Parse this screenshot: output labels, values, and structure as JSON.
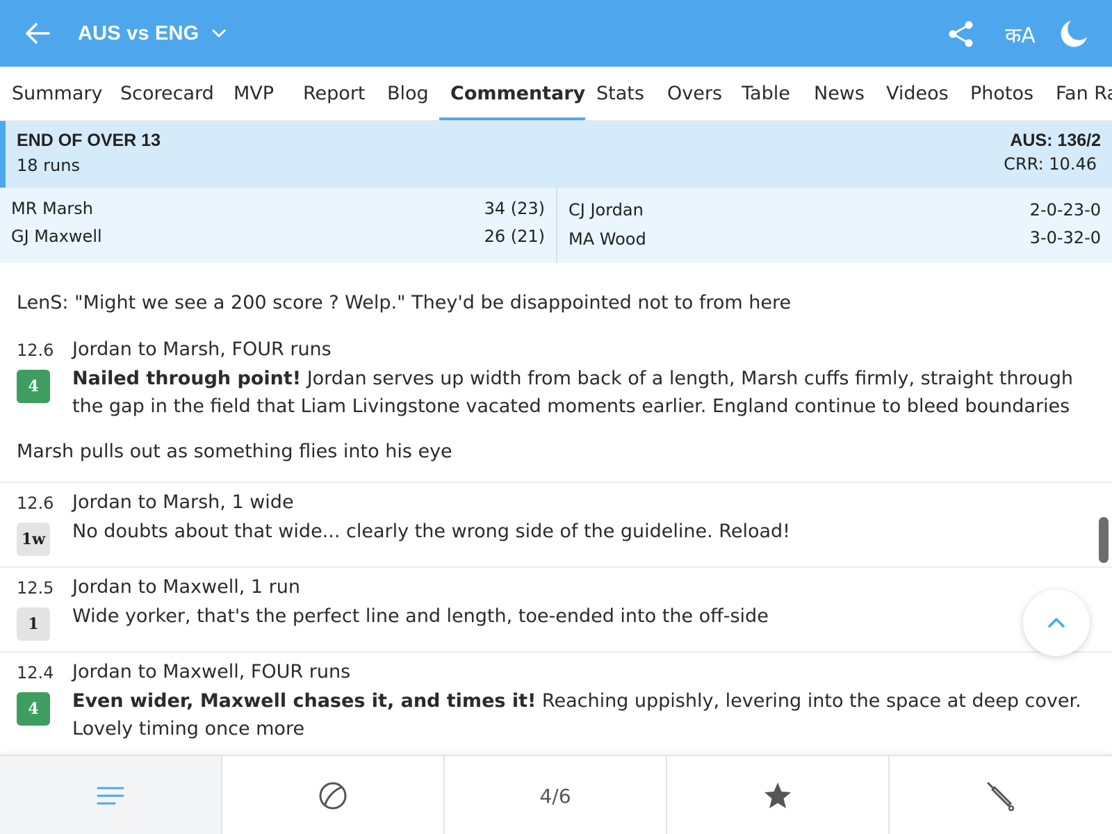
{
  "header": {
    "title": "AUS vs ENG",
    "lang_label": "कA",
    "colors": {
      "bar": "#4ea7ec",
      "accent": "#4ea7ec"
    },
    "icons": [
      "back-arrow-icon",
      "chevron-down-icon",
      "share-icon",
      "moon-icon"
    ]
  },
  "tabs": [
    {
      "label": "Summary"
    },
    {
      "label": "Scorecard"
    },
    {
      "label": "MVP"
    },
    {
      "label": "Report"
    },
    {
      "label": "Blog"
    },
    {
      "label": "Commentary",
      "active": true
    },
    {
      "label": "Stats"
    },
    {
      "label": "Overs"
    },
    {
      "label": "Table"
    },
    {
      "label": "News"
    },
    {
      "label": "Videos"
    },
    {
      "label": "Photos"
    },
    {
      "label": "Fan Ra"
    }
  ],
  "over_summary": {
    "title": "END OF OVER 13",
    "runs": "18 runs",
    "score": "AUS: 136/2",
    "crr": "CRR: 10.46",
    "batters": [
      {
        "name": "MR Marsh",
        "score": "34 (23)"
      },
      {
        "name": "GJ Maxwell",
        "score": "26 (21)"
      }
    ],
    "bowlers": [
      {
        "name": "CJ Jordan",
        "figures": "2-0-23-0"
      },
      {
        "name": "MA Wood",
        "figures": "3-0-32-0"
      }
    ]
  },
  "feed": {
    "note1": "LenS: \"Might we see a 200 score ? Welp.\" They'd be disappointed not to from here",
    "note2": "Marsh pulls out as something flies into his eye",
    "balls": [
      {
        "over": "12.6",
        "badge": "4",
        "head": "Jordan to Marsh, FOUR runs",
        "bold": "Nailed through point!",
        "text": " Jordan serves up width from back of a length, Marsh cuffs firmly, straight through the gap in the field that Liam Livingstone vacated moments earlier. England continue to bleed boundaries"
      },
      {
        "over": "12.6",
        "badge": "1w",
        "head": "Jordan to Marsh, 1 wide",
        "bold": "",
        "text": "No doubts about that wide... clearly the wrong side of the guideline. Reload!"
      },
      {
        "over": "12.5",
        "badge": "1",
        "head": "Jordan to Maxwell, 1 run",
        "bold": "",
        "text": "Wide yorker, that's the perfect line and length, toe-ended into the off-side"
      },
      {
        "over": "12.4",
        "badge": "4",
        "head": "Jordan to Maxwell, FOUR runs",
        "bold": "Even wider, Maxwell chases it, and times it!",
        "text": " Reaching uppishly, levering into the space at deep cover. Lovely timing once more"
      }
    ],
    "colors": {
      "boundary_badge": "#3e9e5f",
      "run_badge": "#e4e4e4"
    }
  },
  "bottom_nav": {
    "page": "4/6",
    "icons": [
      "list-icon",
      "ball-icon",
      "star-icon",
      "bat-icon"
    ]
  }
}
